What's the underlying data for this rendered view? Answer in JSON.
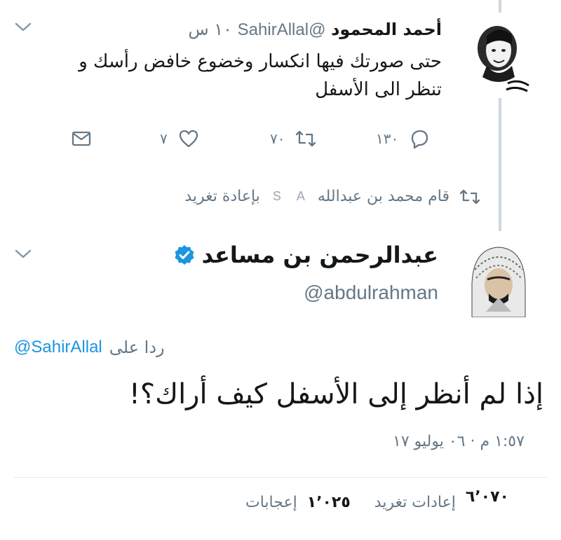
{
  "parent_tweet": {
    "author_name": "أحمد المحمود",
    "handle": "@SahirAllal",
    "time": "١٠ س",
    "text": "حتى صورتك فيها انكسار وخضوع خافض رأسك و تنظر الى الأسفل",
    "avatar_icon": "avatar-portrait",
    "actions": {
      "reply_count": "١٣٠",
      "retweet_count": "٧٠",
      "like_count": "٧"
    }
  },
  "retweet_notice": {
    "text": "قام محمد بن عبدالله",
    "marks": [
      "A",
      "S"
    ],
    "suffix": "بإعادة تغريد"
  },
  "main_tweet": {
    "author_name": "عبدالرحمن بن مساعد",
    "verified": true,
    "handle": "@abdulrahman",
    "reply_prefix": "ردا على",
    "reply_handle": "@SahirAllal",
    "text": "إذا لم أنظر إلى الأسفل كيف أراك؟!",
    "date": "١:٥٧ م · ٠٦ يوليو ١٧",
    "retweets_count": "٦٬٠٧٠",
    "retweets_label": "إعادات تغريد",
    "likes_count": "١٬٠٢٥",
    "likes_label": "إعجابات"
  },
  "colors": {
    "accent": "#1b95e0",
    "muted": "#657786",
    "text": "#14171a",
    "divider": "#e1e8ed"
  }
}
